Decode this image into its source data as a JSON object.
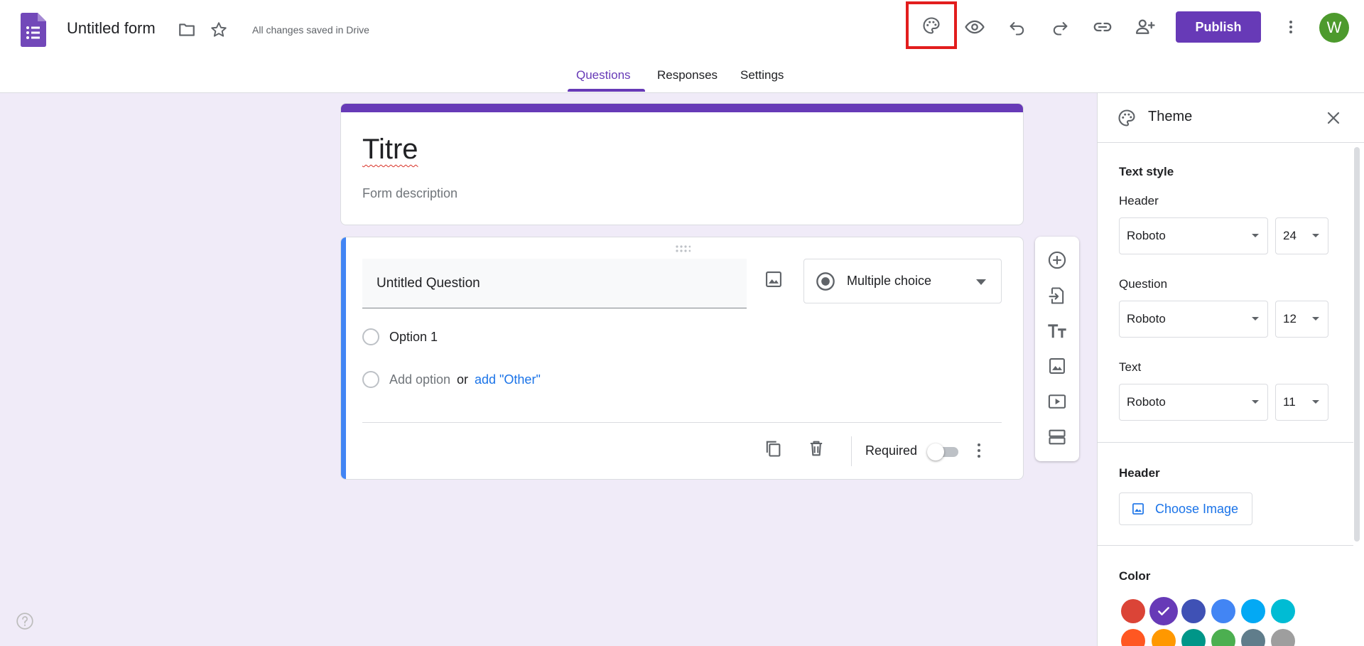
{
  "header": {
    "form_title": "Untitled form",
    "saved_status": "All changes saved in Drive",
    "publish_label": "Publish",
    "avatar_initial": "W",
    "icons": [
      "forms-logo-icon",
      "folder-icon",
      "star-icon",
      "palette-icon",
      "preview-eye-icon",
      "undo-icon",
      "redo-icon",
      "link-icon",
      "add-collaborator-icon",
      "more-vert-icon"
    ]
  },
  "tabs": [
    {
      "label": "Questions",
      "active": true
    },
    {
      "label": "Responses",
      "active": false
    },
    {
      "label": "Settings",
      "active": false
    }
  ],
  "title_card": {
    "title": "Titre",
    "description_placeholder": "Form description"
  },
  "question": {
    "title": "Untitled Question",
    "type": "Multiple choice",
    "option_1": "Option 1",
    "add_option": "Add option",
    "or": "or",
    "add_other": "add \"Other\"",
    "required_label": "Required",
    "required": false
  },
  "side_toolbar": [
    "add-question-icon",
    "import-questions-icon",
    "add-title-icon",
    "add-image-icon",
    "add-video-icon",
    "add-section-icon"
  ],
  "theme_panel": {
    "title": "Theme",
    "text_style_title": "Text style",
    "header_label": "Header",
    "header_font": "Roboto",
    "header_size": "24",
    "question_label": "Question",
    "question_font": "Roboto",
    "question_size": "12",
    "text_label": "Text",
    "text_font": "Roboto",
    "text_size": "11",
    "header_section_title": "Header",
    "choose_image": "Choose Image",
    "color_title": "Color",
    "colors_row1": [
      "#db4437",
      "#673ab7",
      "#3f51b5",
      "#4285f4",
      "#03a9f4",
      "#00bcd4"
    ],
    "colors_row2": [
      "#ff5722",
      "#ff9800",
      "#009688",
      "#4caf50",
      "#607d8b",
      "#9e9e9e"
    ],
    "selected_color": "#673ab7"
  },
  "colors": {
    "accent": "#673ab7",
    "background": "#f0ebf8",
    "question_stripe": "#4285f4",
    "highlight_box": "#e21d1d"
  }
}
